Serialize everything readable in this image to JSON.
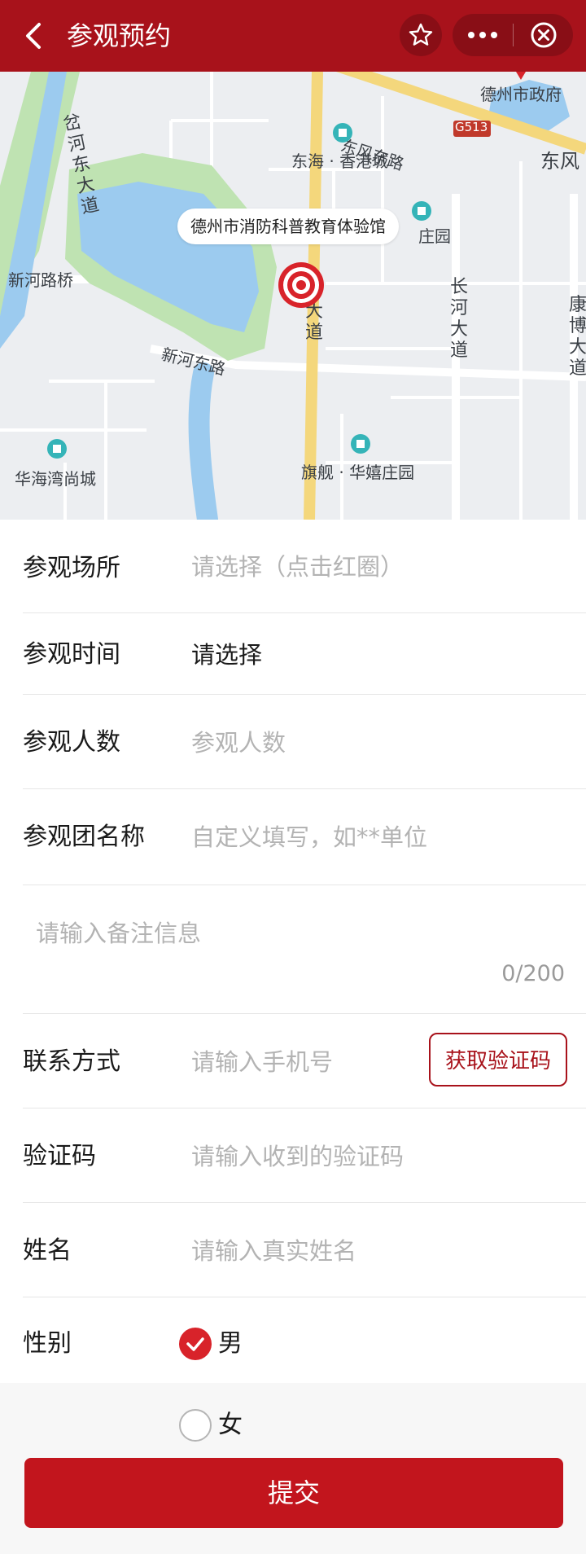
{
  "header": {
    "title": "参观预约",
    "back_icon": "back-icon",
    "star_icon": "star-icon",
    "more_icon": "more-icon",
    "close_icon": "close-circle-icon"
  },
  "map": {
    "callout": "德州市消防科普教育体验馆",
    "labels": {
      "dongfeng_east_road": "东风东路",
      "dezhou_gov": "德州市政府",
      "g513": "G513",
      "dongfeng_edge": "东风",
      "donghai_xianggang": "东海 · 香港城",
      "zhuangyuan": "庄园",
      "fen_he_east_ave": "岔河东大道",
      "xinhe_bridge": "新河路桥",
      "xinhe_east_road": "新河东路",
      "changhe_ave": "长河大道",
      "kangbo_ave": "康博大道",
      "main_ave": "大道",
      "huahai_wan": "华海湾尚城",
      "qijian_huaxi": "旗舰 · 华嬉庄园"
    }
  },
  "form": {
    "venue": {
      "label": "参观场所",
      "placeholder": "请选择（点击红圈）"
    },
    "time": {
      "label": "参观时间",
      "value": "请选择"
    },
    "count": {
      "label": "参观人数",
      "placeholder": "参观人数"
    },
    "group": {
      "label": "参观团名称",
      "placeholder": "自定义填写，如**单位"
    },
    "remark": {
      "placeholder": "请输入备注信息",
      "counter": "0/200"
    },
    "phone": {
      "label": "联系方式",
      "placeholder": "请输入手机号",
      "code_button": "获取验证码"
    },
    "code": {
      "label": "验证码",
      "placeholder": "请输入收到的验证码"
    },
    "name": {
      "label": "姓名",
      "placeholder": "请输入真实姓名"
    },
    "gender": {
      "label": "性别",
      "options": [
        "男",
        "女"
      ],
      "selected": "男"
    },
    "submit": "提交"
  },
  "colors": {
    "brand_red": "#a8121b",
    "button_red": "#c2151d",
    "placeholder_gray": "#b3b3b3"
  }
}
